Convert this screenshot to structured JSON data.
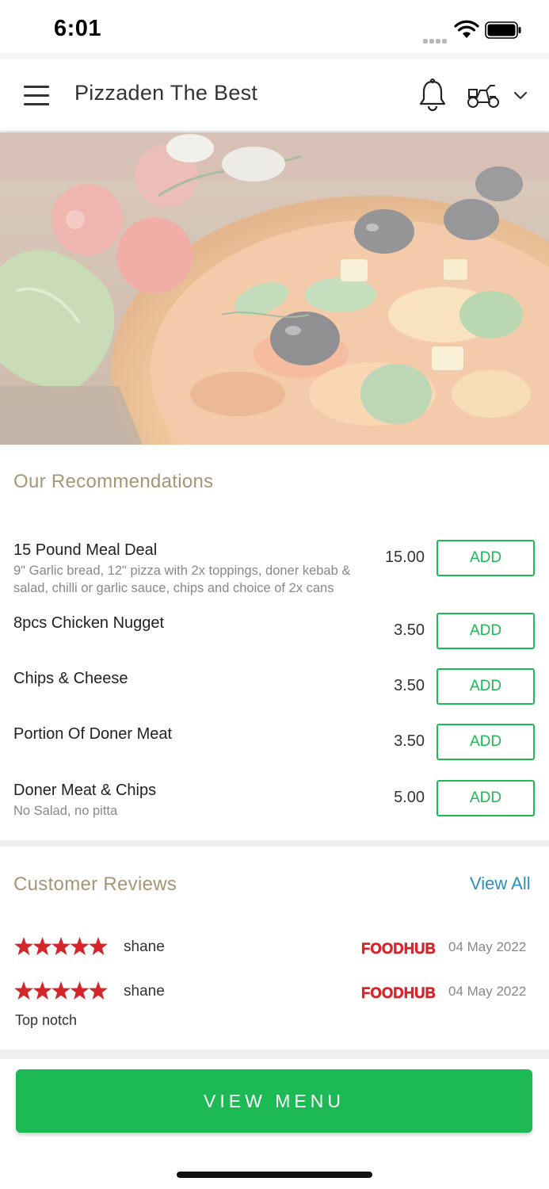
{
  "status_bar": {
    "time": "6:01"
  },
  "header": {
    "title": "Pizzaden The Best"
  },
  "recommendations": {
    "title": "Our Recommendations",
    "items": [
      {
        "name": "15 Pound Meal Deal",
        "description": "9\" Garlic bread, 12\" pizza with 2x toppings, doner kebab & salad, chilli or garlic sauce, chips and choice of 2x cans",
        "price": "15.00",
        "button": "ADD"
      },
      {
        "name": "8pcs Chicken Nugget",
        "description": "",
        "price": "3.50",
        "button": "ADD"
      },
      {
        "name": "Chips & Cheese",
        "description": "",
        "price": "3.50",
        "button": "ADD"
      },
      {
        "name": "Portion Of Doner Meat",
        "description": "",
        "price": "3.50",
        "button": "ADD"
      },
      {
        "name": "Doner Meat & Chips",
        "description": "No Salad, no pitta",
        "price": "5.00",
        "button": "ADD"
      }
    ]
  },
  "reviews": {
    "title": "Customer Reviews",
    "view_all": "View All",
    "items": [
      {
        "rating": 5,
        "reviewer": "shane",
        "source": "FOODHUB",
        "date": "04 May 2022",
        "text": ""
      },
      {
        "rating": 5,
        "reviewer": "shane",
        "source": "FOODHUB",
        "date": "04 May 2022",
        "text": "Top notch"
      }
    ]
  },
  "footer": {
    "view_menu": "VIEW MENU"
  },
  "colors": {
    "accent_green": "#1db954",
    "section_title": "#a89575",
    "link_blue": "#2a8fc4",
    "star_red": "#d6252b"
  }
}
